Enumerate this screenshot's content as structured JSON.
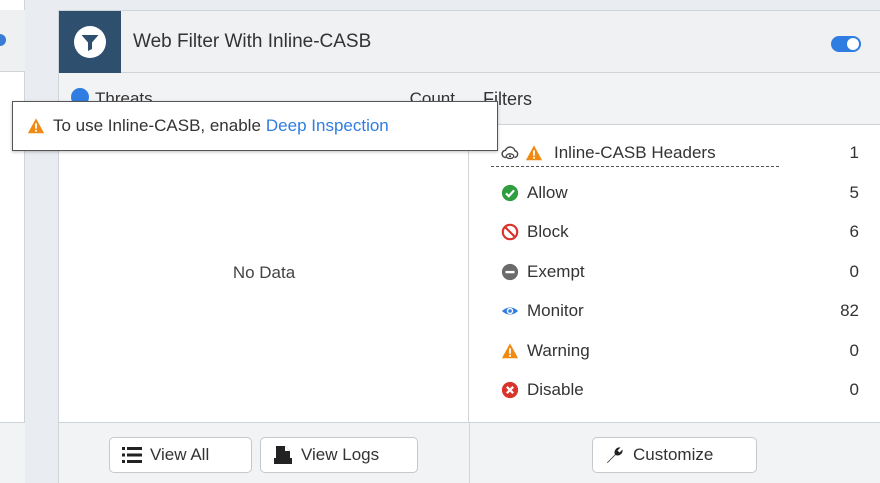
{
  "widget": {
    "title": "Web Filter With Inline-CASB",
    "toggle_on": true,
    "accent": "#2f7de1",
    "header_icon_bg": "#2f4f6e",
    "header_icon": "filter-icon"
  },
  "threats": {
    "label": "Threats",
    "count_label": "Count",
    "empty_text": "No Data"
  },
  "filters": {
    "label": "Filters",
    "items": [
      {
        "name": "Inline-CASB Headers",
        "count": "1",
        "icon": "cloud-eye-icon",
        "status_icon": "warning-icon"
      },
      {
        "name": "Allow",
        "count": "5",
        "icon": "check-circle-icon",
        "color": "#2e9e3f"
      },
      {
        "name": "Block",
        "count": "6",
        "icon": "block-icon",
        "color": "#d9342b"
      },
      {
        "name": "Exempt",
        "count": "0",
        "icon": "minus-circle-icon",
        "color": "#6b6b6b"
      },
      {
        "name": "Monitor",
        "count": "82",
        "icon": "eye-icon",
        "color": "#2f7de1"
      },
      {
        "name": "Warning",
        "count": "0",
        "icon": "warning-icon",
        "color": "#f08a12"
      },
      {
        "name": "Disable",
        "count": "0",
        "icon": "x-circle-icon",
        "color": "#d9342b"
      }
    ]
  },
  "footer": {
    "view_all": "View All",
    "view_logs": "View Logs",
    "customize": "Customize"
  },
  "tooltip": {
    "text": "To use Inline-CASB, enable",
    "link": "Deep Inspection"
  }
}
